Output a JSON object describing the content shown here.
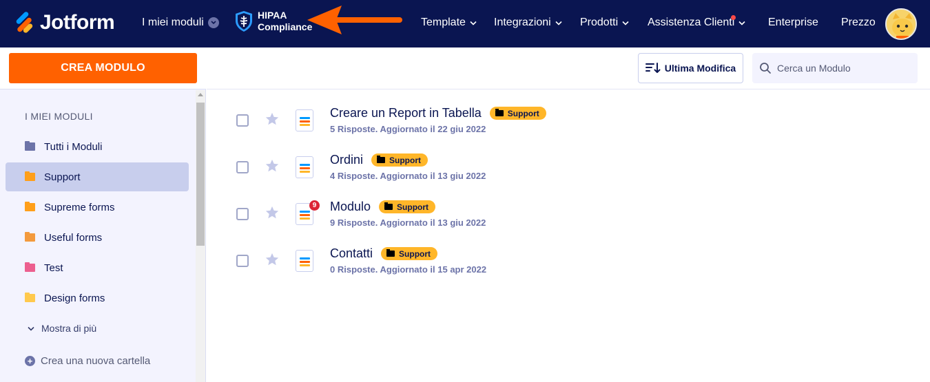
{
  "header": {
    "brand": "Jotform",
    "my_modules": "I miei moduli",
    "hipaa_line1": "HIPAA",
    "hipaa_line2": "Compliance",
    "nav": [
      {
        "label": "Template"
      },
      {
        "label": "Integrazioni"
      },
      {
        "label": "Prodotti"
      },
      {
        "label": "Assistenza Clienti"
      },
      {
        "label": "Enterprise"
      },
      {
        "label": "Prezzo"
      }
    ]
  },
  "sidebar": {
    "create_label": "CREA MODULO",
    "section_title": "I MIEI MODULI",
    "folders": [
      {
        "label": "Tutti i Moduli",
        "color": "#6c73a8"
      },
      {
        "label": "Support",
        "color": "#ff9f1a"
      },
      {
        "label": "Supreme forms",
        "color": "#ff9f1a"
      },
      {
        "label": "Useful forms",
        "color": "#f39a3d"
      },
      {
        "label": "Test",
        "color": "#ec5f8f"
      },
      {
        "label": "Design forms",
        "color": "#ffc94d"
      }
    ],
    "show_more": "Mostra di più",
    "new_folder": "Crea una nuova cartella"
  },
  "toolbar": {
    "sort_label": "Ultima Modifica",
    "search_placeholder": "Cerca un Modulo"
  },
  "forms": [
    {
      "title": "Creare un Report in Tabella",
      "tag": "Support",
      "meta": "5 Risposte. Aggiornato il 22 giu 2022"
    },
    {
      "title": "Ordini",
      "tag": "Support",
      "meta": "4 Risposte. Aggiornato il 13 giu 2022"
    },
    {
      "title": "Modulo",
      "tag": "Support",
      "meta": "9 Risposte. Aggiornato il 13 giu 2022",
      "badge": "9"
    },
    {
      "title": "Contatti",
      "tag": "Support",
      "meta": "0 Risposte. Aggiornato il 15 apr 2022"
    }
  ],
  "colors": {
    "header_bg": "#0a1551",
    "accent": "#ff6100",
    "tag": "#ffb629",
    "arrow": "#ff6100"
  }
}
